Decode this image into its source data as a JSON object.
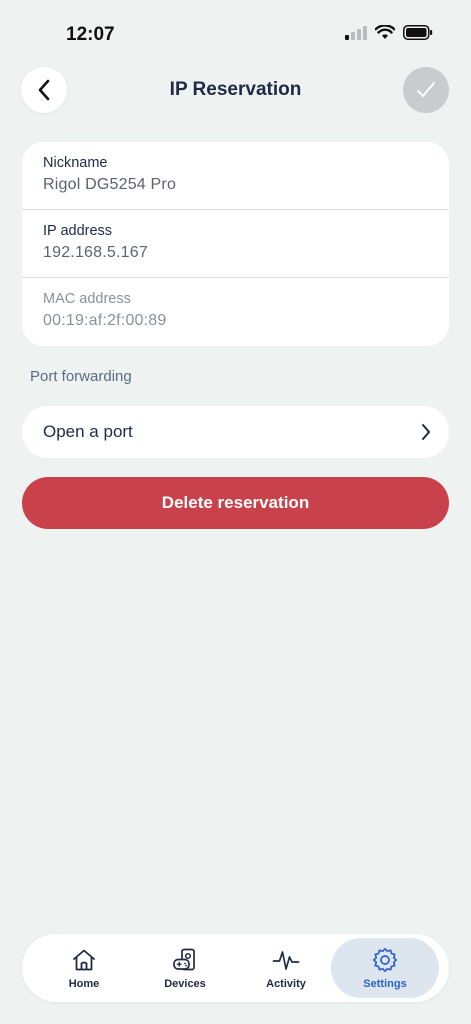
{
  "status_bar": {
    "time": "12:07"
  },
  "header": {
    "title": "IP Reservation"
  },
  "form": {
    "nickname": {
      "label": "Nickname",
      "value": "Rigol DG5254 Pro"
    },
    "ip_address": {
      "label": "IP address",
      "value": "192.168.5.167"
    },
    "mac_address": {
      "label": "MAC address",
      "value": "00:19:af:2f:00:89"
    }
  },
  "port_forwarding": {
    "section_label": "Port forwarding",
    "open_port_label": "Open a port"
  },
  "actions": {
    "delete_label": "Delete reservation"
  },
  "tabs": [
    {
      "label": "Home",
      "icon": "home-icon"
    },
    {
      "label": "Devices",
      "icon": "devices-icon"
    },
    {
      "label": "Activity",
      "icon": "activity-icon"
    },
    {
      "label": "Settings",
      "icon": "gear-icon",
      "active": true
    }
  ],
  "colors": {
    "background": "#eef3f1",
    "danger": "#c8414b",
    "accent": "#2a63c9",
    "text": "#1f2a44"
  }
}
